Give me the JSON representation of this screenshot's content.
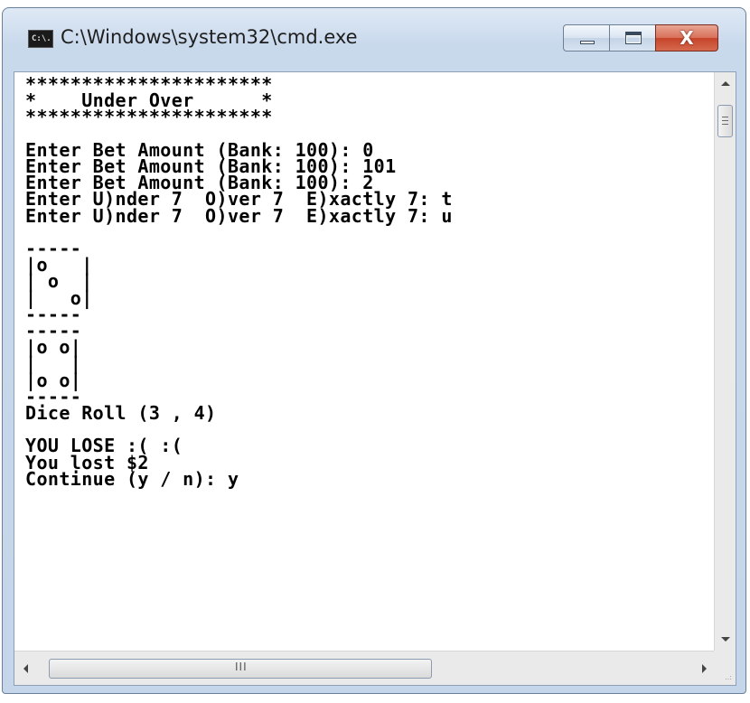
{
  "window": {
    "title": "C:\\Windows\\system32\\cmd.exe",
    "icon_text": "C:\\.",
    "close_glyph": "X"
  },
  "console": {
    "lines": [
      "**********************",
      "*    Under Over      *",
      "**********************",
      "",
      "Enter Bet Amount (Bank: 100): 0",
      "Enter Bet Amount (Bank: 100): 101",
      "Enter Bet Amount (Bank: 100): 2",
      "Enter U)nder 7  O)ver 7  E)xactly 7: t",
      "Enter U)nder 7  O)ver 7  E)xactly 7: u",
      "",
      "-----",
      "|o   |",
      "| o  |",
      "|   o|",
      "-----",
      "-----",
      "|o o|",
      "|   |",
      "|o o|",
      "-----",
      "Dice Roll (3 , 4)",
      "",
      "YOU LOSE :( :(",
      "You lost $2",
      "Continue (y / n): y"
    ]
  },
  "scrollbar": {
    "horizontal_grip": "III",
    "resize_grip": "..:"
  }
}
